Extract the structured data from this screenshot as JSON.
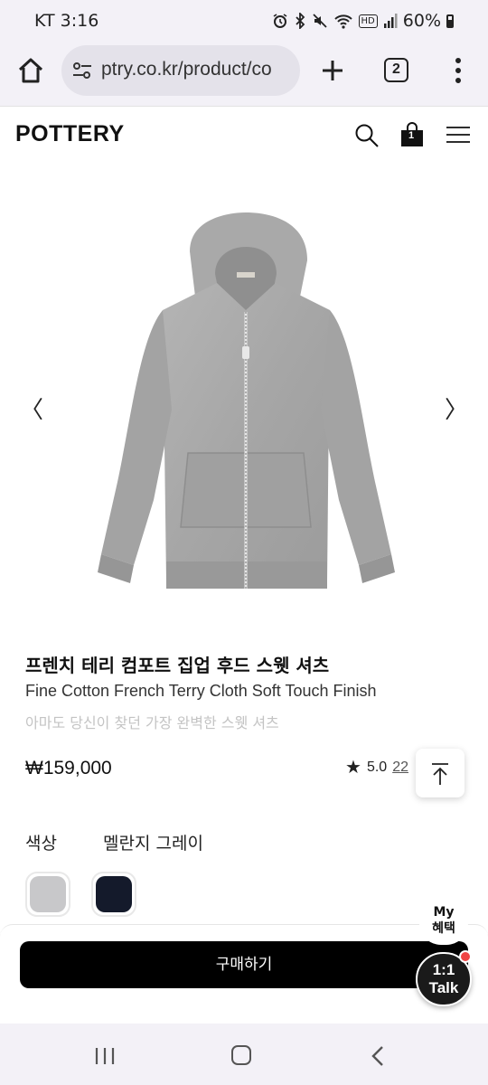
{
  "status": {
    "carrier_time": "KT 3:16",
    "battery": "60%",
    "hd_badge": "HD"
  },
  "browser": {
    "url": "ptry.co.kr/product/co",
    "tab_count": "2"
  },
  "site": {
    "logo": "POTTERY",
    "cart_count": "1"
  },
  "gallery": {
    "prev": "〈",
    "next": "〉"
  },
  "product": {
    "title": "프렌치 테리 컴포트 집업 후드 스웻 셔츠",
    "subtitle": "Fine Cotton French Terry Cloth Soft Touch Finish",
    "tagline": "아마도 당신이 찾던 가장 완벽한 스웻 셔츠",
    "price": "₩159,000",
    "rating": "5.0",
    "review_count": "22"
  },
  "options": {
    "color_label": "색상",
    "color_value": "멜란지 그레이",
    "swatches": [
      {
        "name": "melange-gray",
        "color": "#c8c8ca"
      },
      {
        "name": "navy",
        "color": "#141a2b"
      }
    ]
  },
  "actions": {
    "buy_label": "구매하기",
    "my_benefit_line1": "My",
    "my_benefit_line2": "혜택",
    "talk_line1": "1:1",
    "talk_line2": "Talk"
  },
  "colors": {
    "accent_dark": "#000000",
    "notification_red": "#ef4444",
    "chrome_bg": "#f3f1f7"
  }
}
